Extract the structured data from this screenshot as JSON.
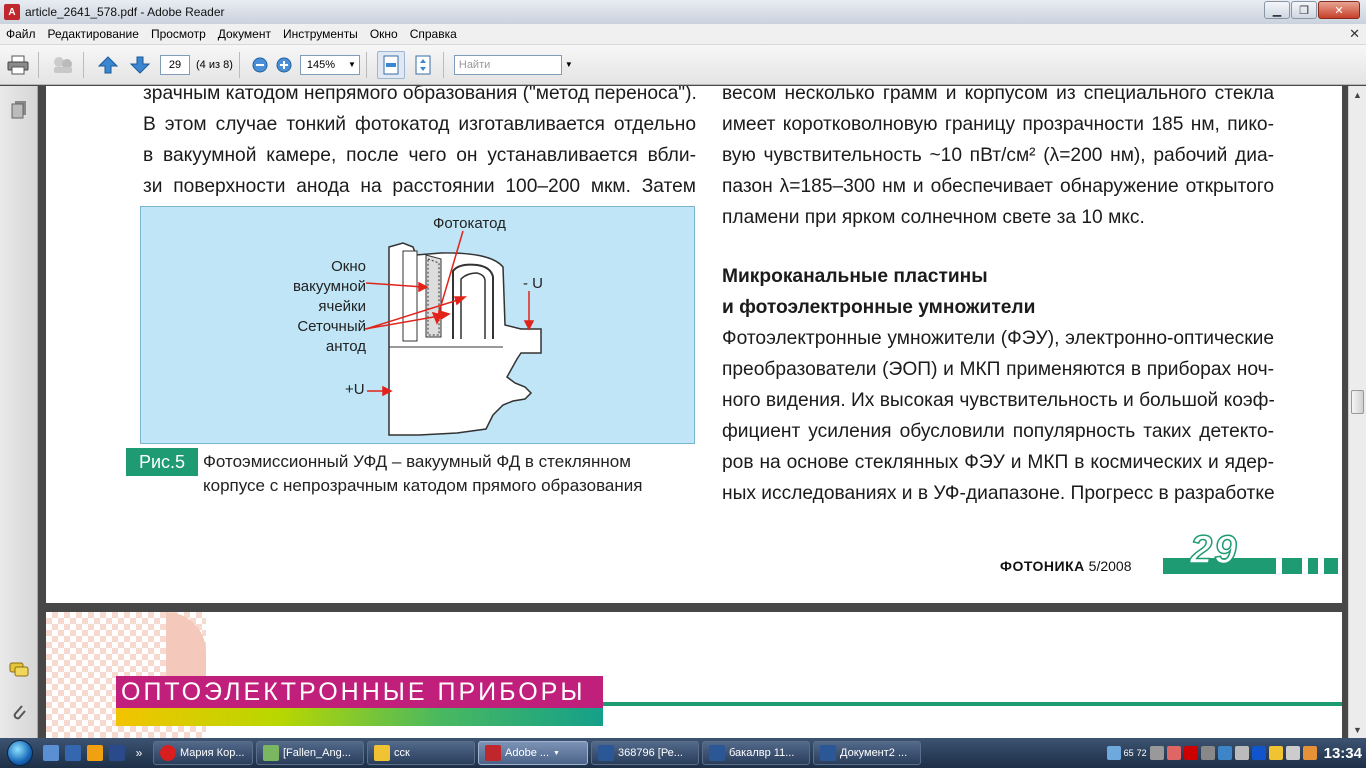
{
  "window": {
    "title": "article_2641_578.pdf - Adobe Reader"
  },
  "menu": [
    "Файл",
    "Редактирование",
    "Просмотр",
    "Документ",
    "Инструменты",
    "Окно",
    "Справка"
  ],
  "toolbar": {
    "page_number": "29",
    "page_count": "(4 из 8)",
    "zoom": "145%",
    "find_placeholder": "Найти"
  },
  "page1": {
    "left_lines": [
      "зрачным катодом непрямого образования (\"метод переноса\").",
      "В этом случае тонкий фотокатод изготавливается отдельно",
      "в вакуумной камере, после чего он устанавливается вбли-",
      "зи поверхности анода на расстоянии 100–200 мкм. Затем"
    ],
    "right_lines_top": [
      "весом несколько грамм и корпусом из специального стекла",
      "имеет коротковолновую границу прозрачности 185 нм, пико-",
      "вую чувствительность ~10 пВт/см² (λ=200 нм), рабочий диа-",
      "пазон λ=185–300 нм и обеспечивает обнаружение открытого",
      "пламени при ярком солнечном свете за 10 мкс."
    ],
    "heading": [
      "Микроканальные пластины",
      "и фотоэлектронные умножители"
    ],
    "right_lines_bottom": [
      "Фотоэлектронные умножители (ФЭУ), электронно-оптические",
      "преобразователи (ЭОП) и МКП применяются в приборах ноч-",
      "ного видения. Их высокая чувствительность и большой коэф-",
      "фициент усиления обусловили популярность таких детекто-",
      "ров на основе стеклянных ФЭУ и МКП в космических и ядер-",
      "ных исследованиях и в УФ-диапазоне. Прогресс в разработке"
    ],
    "figure": {
      "label_photocathode": "Фотокатод",
      "label_window": [
        "Окно",
        "вакуумной",
        "ячейки"
      ],
      "label_anode": [
        "Сеточный",
        "антод"
      ],
      "label_minus_u": "- U",
      "label_plus_u": "+U"
    },
    "caption_tag": "Рис.5",
    "caption": [
      "Фотоэмиссионный УФД – вакуумный ФД в стеклянном",
      "корпусе с непрозрачным катодом прямого образования"
    ],
    "footer_magazine": "ФОТОНИКА",
    "footer_issue": "5/2008",
    "page_number": "29"
  },
  "page2": {
    "section_title": "ОПТОЭЛЕКТРОННЫЕ ПРИБОРЫ"
  },
  "taskbar": {
    "tasks": [
      {
        "label": "Мария Кор...",
        "color": "#d81e1e"
      },
      {
        "label": "[Fallen_Ang...",
        "color": "#7bb661"
      },
      {
        "label": "сск",
        "color": "#f1c232"
      },
      {
        "label": "Adobe ...",
        "color": "#c0272d",
        "active": true
      },
      {
        "label": "368796 [Ре...",
        "color": "#2b5797"
      },
      {
        "label": "бакалвр 11...",
        "color": "#2b5797"
      },
      {
        "label": "Документ2 ...",
        "color": "#2b5797"
      }
    ],
    "tray_numbers": [
      "65",
      "72"
    ],
    "clock": "13:34"
  },
  "colors": {
    "accent_green": "#1f9b74",
    "magenta": "#c11f7c",
    "figure_bg": "#bfe5f6"
  }
}
